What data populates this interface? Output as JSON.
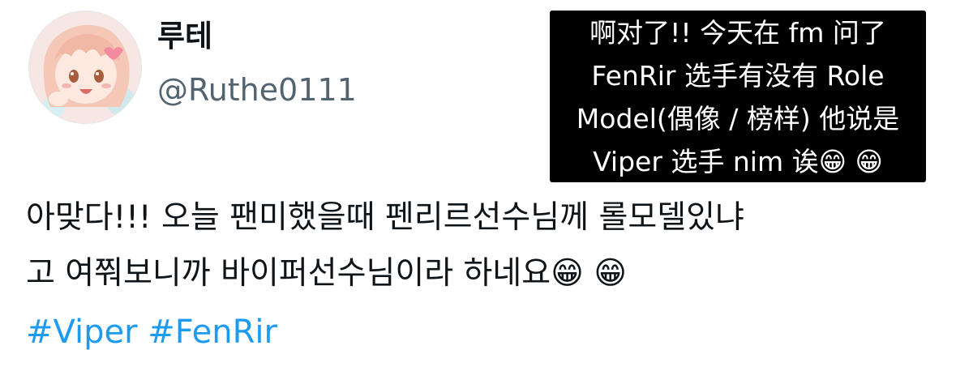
{
  "author": {
    "display_name": "루테",
    "handle": "@Ruthe0111",
    "avatar_icon": "anime-girl-avatar-icon"
  },
  "translation": {
    "lines": [
      "啊对了!! 今天在 fm 问了",
      "FenRir 选手有没有 Role",
      "Model(偶像 / 榜样) 他说是",
      "Viper 选手 nim 诶😁 😁"
    ]
  },
  "tweet": {
    "lines": [
      "아맞다!!! 오늘 팬미했을때 펜리르선수님께 롤모델있냐",
      "고 여쭤보니까 바이퍼선수님이라 하네요😁 😁"
    ],
    "hashtags": [
      "#Viper",
      "#FenRir"
    ]
  },
  "colors": {
    "hashtag": "#1d9bf0",
    "handle": "#536471",
    "text": "#0f1419",
    "translation_bg": "#000000"
  }
}
